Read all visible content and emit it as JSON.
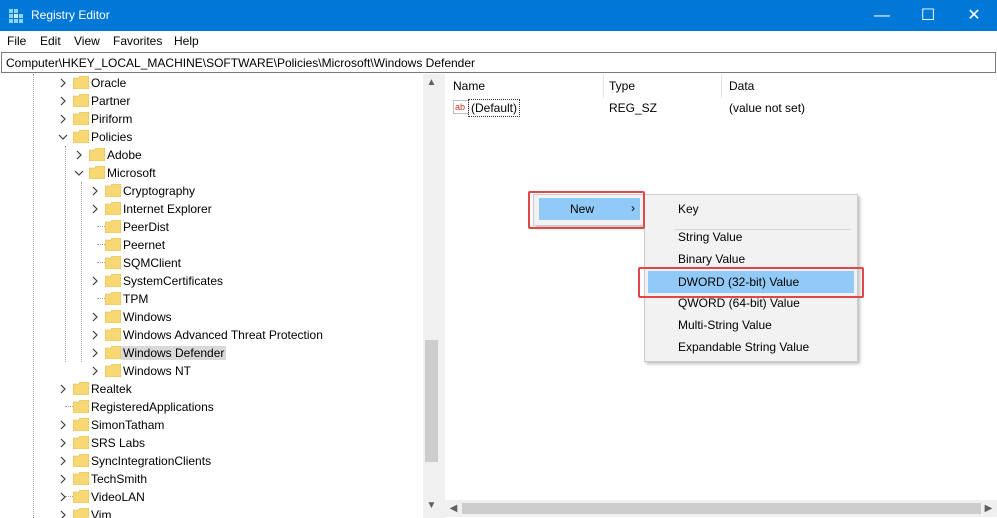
{
  "window": {
    "title": "Registry Editor",
    "minimize_glyph": "—",
    "maximize_glyph": "☐",
    "close_glyph": "✕"
  },
  "menu": [
    "File",
    "Edit",
    "View",
    "Favorites",
    "Help"
  ],
  "address": "Computer\\HKEY_LOCAL_MACHINE\\SOFTWARE\\Policies\\Microsoft\\Windows Defender",
  "tree": {
    "level1_top": [
      "Oracle",
      "Partner",
      "Piriform",
      "Policies"
    ],
    "policies_children": [
      "Adobe",
      "Microsoft"
    ],
    "microsoft_children": [
      "Cryptography",
      "Internet Explorer",
      "PeerDist",
      "Peernet",
      "SQMClient",
      "SystemCertificates",
      "TPM",
      "Windows",
      "Windows Advanced Threat Protection",
      "Windows Defender",
      "Windows NT"
    ],
    "level1_bottom": [
      "Realtek",
      "RegisteredApplications",
      "SimonTatham",
      "SRS Labs",
      "SyncIntegrationClients",
      "TechSmith",
      "VideoLAN",
      "Vim"
    ],
    "selected": "Windows Defender"
  },
  "values_pane": {
    "columns": {
      "name": "Name",
      "type": "Type",
      "data": "Data"
    },
    "rows": [
      {
        "name": "(Default)",
        "type": "REG_SZ",
        "data": "(value not set)",
        "icon": "ab"
      }
    ]
  },
  "context_menu": {
    "new_label": "New",
    "new_arrow": "›",
    "submenu": [
      "Key",
      "String Value",
      "Binary Value",
      "DWORD (32-bit) Value",
      "QWORD (64-bit) Value",
      "Multi-String Value",
      "Expandable String Value"
    ],
    "highlighted": "DWORD (32-bit) Value"
  },
  "colors": {
    "titlebar": "#0078d7",
    "highlight": "#91c9f7",
    "annotation_box": "#e04848",
    "folder": "#f8d775"
  }
}
